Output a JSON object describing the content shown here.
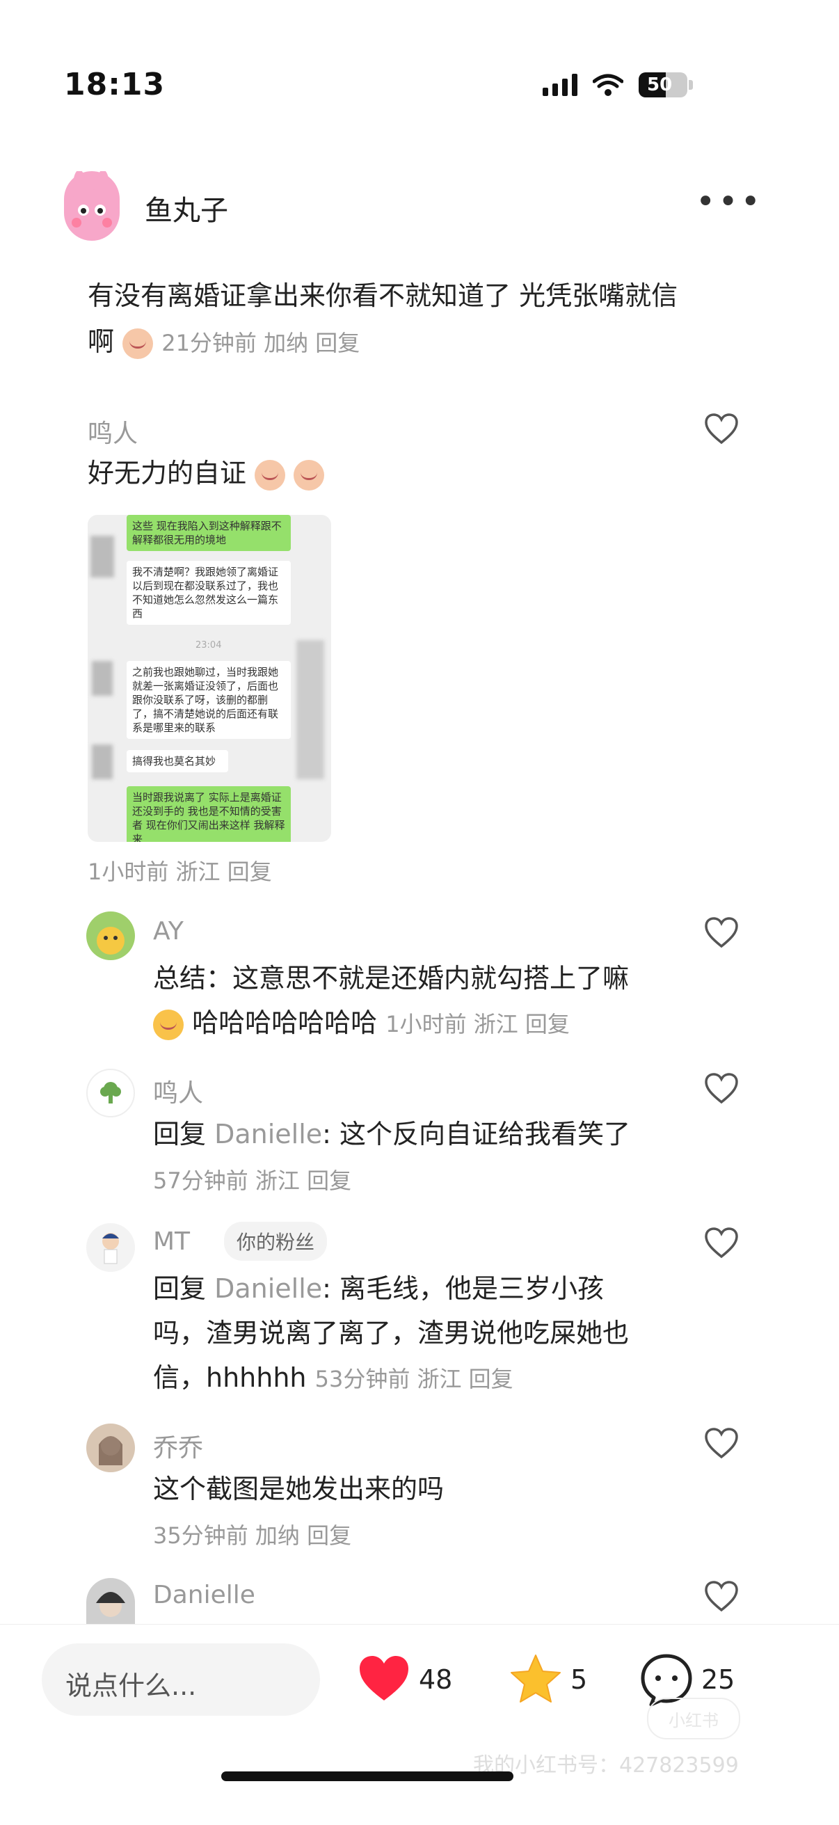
{
  "status_bar": {
    "time": "18:13",
    "battery": "50"
  },
  "post": {
    "author": "鱼丸子",
    "text": "有没有离婚证拿出来你看不就知道了 光凭张嘴就信啊",
    "meta": "21分钟前 加纳 回复"
  },
  "comments": [
    {
      "name": "鸣人",
      "text": "好无力的自证",
      "screenshot_lines": [
        "这些 现在我陷入到这种解释跟不解释都很无用的境地",
        "我不清楚啊？我跟她领了离婚证以后到现在都没联系过了，我也不知道她怎么忽然发这么一篇东西",
        "23:04",
        "之前我也跟她聊过，当时我跟她就差一张离婚证没领了，后面也跟你没联系了呀，该删的都删了，搞不清楚她说的后面还有联系是哪里来的联系",
        "搞得我也莫名其妙",
        "当时跟我说离了 实际上是离婚证还没到手的 我也是不知情的受害者 现在你们又闹出来这样 我解释来"
      ],
      "meta": "1小时前 浙江 回复"
    },
    {
      "name": "AY",
      "text": "总结：这意思不就是还婚内就勾搭上了嘛",
      "text2": "哈哈哈哈哈哈哈",
      "meta": "1小时前 浙江 回复"
    },
    {
      "name": "鸣人",
      "reply_prefix": "回复",
      "reply_to": "Danielle",
      "text": ": 这个反向自证给我看笑了",
      "meta": "57分钟前 浙江 回复"
    },
    {
      "name": "MT",
      "badge": "你的粉丝",
      "reply_prefix": "回复",
      "reply_to": "Danielle",
      "line1": ": 离毛线，他是三岁小孩",
      "line2": "吗，渣男说离了离了，渣男说他吃屎她也",
      "line3": "信，hhhhhh",
      "meta": "53分钟前 浙江 回复"
    },
    {
      "name": "乔乔",
      "text": "这个截图是她发出来的吗",
      "meta": "35分钟前 加纳 回复"
    },
    {
      "name": "Danielle"
    }
  ],
  "bottom_bar": {
    "input_placeholder": "说点什么...",
    "likes": "48",
    "stars": "5",
    "comments": "25"
  },
  "watermark": {
    "text": "我的小红书号：427823599",
    "logo": "小红书"
  },
  "colors": {
    "like_red": "#ff2442",
    "star_yellow": "#fbc02d",
    "meta_gray": "#999999"
  }
}
